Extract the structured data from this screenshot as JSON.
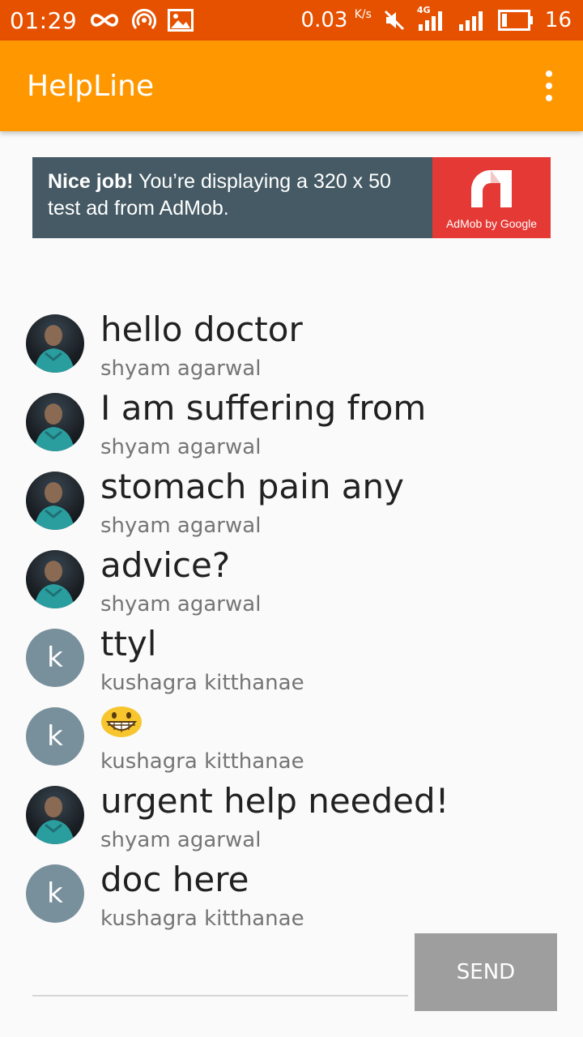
{
  "status_bar": {
    "time": "01:29",
    "speed": "0.03",
    "speed_unit": "K/s",
    "network": "4G",
    "battery": "16",
    "icons": [
      "infinity-icon",
      "hotspot-icon",
      "image-icon",
      "mute-icon",
      "signal-4g-icon",
      "signal-icon",
      "battery-icon"
    ]
  },
  "app_bar": {
    "title": "HelpLine",
    "menu_icon": "overflow-menu-icon"
  },
  "ad": {
    "headline": "Nice job!",
    "body": " You’re displaying a 320 x 50 test ad from AdMob.",
    "logo_caption": "AdMob by Google"
  },
  "messages": [
    {
      "text": "hello doctor",
      "author": "shyam agarwal",
      "avatar": "photo"
    },
    {
      "text": "I am suffering from",
      "author": "shyam agarwal",
      "avatar": "photo"
    },
    {
      "text": "stomach pain any",
      "author": "shyam agarwal",
      "avatar": "photo"
    },
    {
      "text": "advice?",
      "author": "shyam agarwal",
      "avatar": "photo"
    },
    {
      "text": "ttyl",
      "author": "kushagra kitthanae",
      "avatar": "letter",
      "letter": "k"
    },
    {
      "text": "",
      "author": "kushagra kitthanae",
      "avatar": "letter",
      "letter": "k",
      "emoji": "grinning-face-icon"
    },
    {
      "text": "urgent help needed!",
      "author": "shyam agarwal",
      "avatar": "photo"
    },
    {
      "text": "doc here",
      "author": "kushagra kitthanae",
      "avatar": "letter",
      "letter": "k"
    }
  ],
  "composer": {
    "value": "",
    "placeholder": "",
    "send_label": "SEND"
  },
  "colors": {
    "status_bar": "#e65100",
    "app_bar": "#ff9800",
    "ad_bg": "#455a64",
    "ad_logo": "#e53935",
    "letter_avatar": "#78909c",
    "send_button": "#9e9e9e"
  }
}
